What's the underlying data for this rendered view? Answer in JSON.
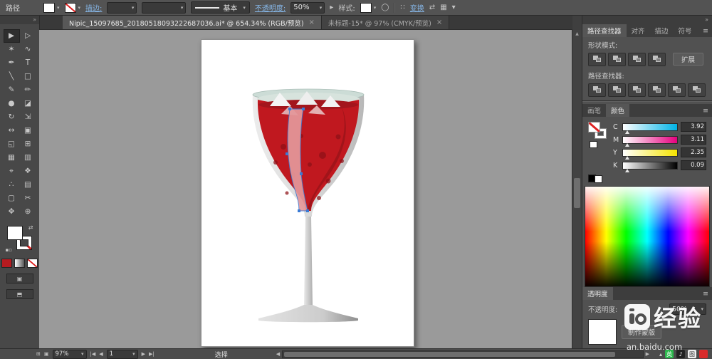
{
  "colors": {
    "link-blue": "#86b7e8",
    "wine-red": "#c0181f",
    "wine-surface": "#a3161d",
    "wine-highlight": "#e4989b",
    "selection-blue": "#3a7bd5"
  },
  "control_bar": {
    "selection_type": "路径",
    "stroke_label": "描边:",
    "brush_value": "基本",
    "opacity_label": "不透明度:",
    "opacity_value": "50%",
    "style_label": "样式:",
    "transform_label": "变换"
  },
  "document_tabs": [
    {
      "title": "Nipic_15097685_20180518093222687036.ai* @ 654.34% (RGB/预览)",
      "close": "×"
    },
    {
      "title": "未标题-15* @ 97% (CMYK/预览)",
      "close": "×"
    }
  ],
  "tools": [
    {
      "name": "selection-tool",
      "glyph": "▶"
    },
    {
      "name": "direct-selection-tool",
      "glyph": "▷"
    },
    {
      "name": "magic-wand-tool",
      "glyph": "✶"
    },
    {
      "name": "lasso-tool",
      "glyph": "∿"
    },
    {
      "name": "pen-tool",
      "glyph": "✒"
    },
    {
      "name": "type-tool",
      "glyph": "T"
    },
    {
      "name": "line-segment-tool",
      "glyph": "╲"
    },
    {
      "name": "rectangle-tool",
      "glyph": "□"
    },
    {
      "name": "paintbrush-tool",
      "glyph": "✎"
    },
    {
      "name": "pencil-tool",
      "glyph": "✏"
    },
    {
      "name": "blob-brush-tool",
      "glyph": "●"
    },
    {
      "name": "eraser-tool",
      "glyph": "◪"
    },
    {
      "name": "rotate-tool",
      "glyph": "↻"
    },
    {
      "name": "scale-tool",
      "glyph": "⇲"
    },
    {
      "name": "width-tool",
      "glyph": "↔"
    },
    {
      "name": "free-transform-tool",
      "glyph": "▣"
    },
    {
      "name": "shape-builder-tool",
      "glyph": "◱"
    },
    {
      "name": "perspective-grid-tool",
      "glyph": "⊞"
    },
    {
      "name": "mesh-tool",
      "glyph": "▦"
    },
    {
      "name": "gradient-tool",
      "glyph": "▥"
    },
    {
      "name": "eyedropper-tool",
      "glyph": "⌖"
    },
    {
      "name": "blend-tool",
      "glyph": "❖"
    },
    {
      "name": "symbol-sprayer-tool",
      "glyph": "∴"
    },
    {
      "name": "column-graph-tool",
      "glyph": "▤"
    },
    {
      "name": "artboard-tool",
      "glyph": "▢"
    },
    {
      "name": "slice-tool",
      "glyph": "✂"
    },
    {
      "name": "hand-tool",
      "glyph": "✥"
    },
    {
      "name": "zoom-tool",
      "glyph": "⊕"
    }
  ],
  "pathfinder_panel": {
    "tabs": [
      "路径查找器",
      "对齐",
      "描边",
      "符号"
    ],
    "shape_modes_label": "形状模式:",
    "expand_button": "扩展",
    "pathfinder_label": "路径查找器:",
    "shape_mode_buttons": [
      "shape-mode-unite",
      "shape-mode-minus-front",
      "shape-mode-intersect",
      "shape-mode-exclude"
    ],
    "pathfinder_buttons": [
      "pathfinder-divide",
      "pathfinder-trim",
      "pathfinder-merge",
      "pathfinder-crop",
      "pathfinder-outline",
      "pathfinder-minus-back"
    ]
  },
  "color_panel": {
    "tabs": [
      "画笔",
      "颜色"
    ],
    "sliders": [
      {
        "channel": "C",
        "value": "3.92"
      },
      {
        "channel": "M",
        "value": "3.11"
      },
      {
        "channel": "Y",
        "value": "2.35"
      },
      {
        "channel": "K",
        "value": "0.09"
      }
    ]
  },
  "transparency_panel": {
    "tab": "透明度",
    "opacity_label": "不透明度:",
    "opacity_value": "50%",
    "make_mask_button": "制作蒙版"
  },
  "status_bar": {
    "zoom": "97%",
    "artboard_number": "1",
    "tool_name": "选择"
  },
  "watermark": {
    "brand": "经验",
    "url": "an.baidu.com"
  },
  "tray_icons": [
    {
      "label": "英"
    },
    {
      "label": "♪"
    },
    {
      "label": "图"
    },
    {
      "label": ""
    }
  ]
}
